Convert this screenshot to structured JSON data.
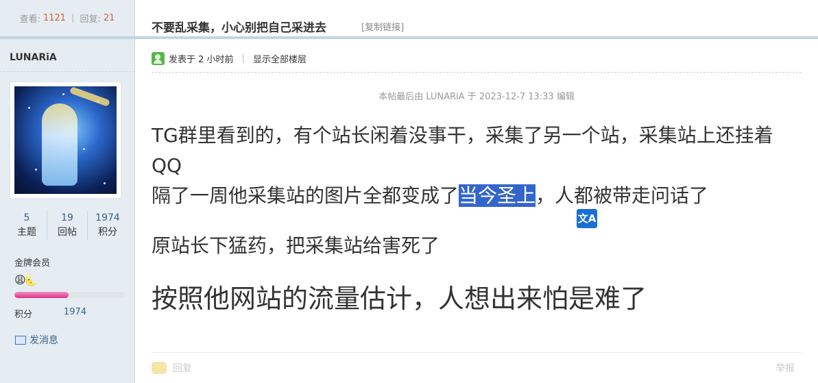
{
  "sidebar": {
    "views_label": "查看:",
    "views_value": "1121",
    "replies_label": "回复:",
    "replies_value": "21",
    "username": "LUNARiA",
    "stats": [
      {
        "value": "5",
        "label": "主题"
      },
      {
        "value": "19",
        "label": "回帖"
      },
      {
        "value": "1974",
        "label": "积分"
      }
    ],
    "rank_name": "金牌会员",
    "rank_icons": "😩🌜",
    "rank_progress": 0.49,
    "points_label": "积分",
    "points_value": "1974",
    "pm_label": "发消息"
  },
  "thread": {
    "title": "不要乱采集，小心别把自己采进去",
    "copy_link": "[复制链接]"
  },
  "post": {
    "posted_at": "发表于 2 小时前",
    "show_all": "显示全部楼层",
    "edited_note": "本帖最后由 LUNARiA 于 2023-12-7 13:33 编辑",
    "line1": "TG群里看到的，有个站长闲着没事干，采集了另一个站，采集站上还挂着QQ",
    "line2_before": "隔了一周他采集站的图片全都变成了",
    "line2_selected": "当今圣上",
    "line2_after": "，人都被带走问话了",
    "line3": "原站长下猛药，把采集站给害死了",
    "line4": "按照他网站的流量估计，人想出来怕是难了",
    "translate_icon": "文A",
    "reply_label": "回复",
    "report_label": "举报"
  },
  "colors": {
    "sidebar_bg": "#e5edf2",
    "accent_red": "#e05a3a",
    "link_blue": "#3a5f8a",
    "selection": "#3366cc"
  }
}
